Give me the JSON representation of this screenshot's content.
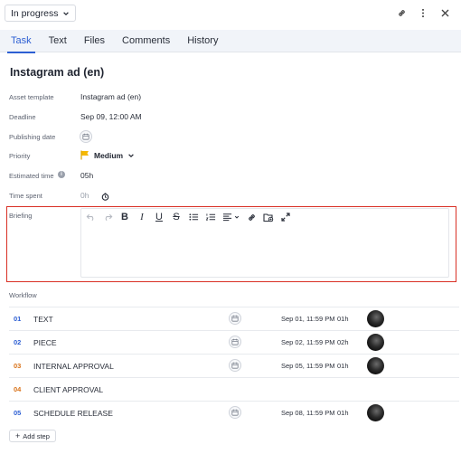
{
  "status": {
    "label": "In progress"
  },
  "tabs": [
    {
      "label": "Task"
    },
    {
      "label": "Text"
    },
    {
      "label": "Files"
    },
    {
      "label": "Comments"
    },
    {
      "label": "History"
    }
  ],
  "title": "Instagram ad (en)",
  "fields": {
    "asset_template": {
      "label": "Asset template",
      "value": "Instagram ad (en)"
    },
    "deadline": {
      "label": "Deadline",
      "value": "Sep 09, 12:00 AM"
    },
    "publishing_date": {
      "label": "Publishing date"
    },
    "priority": {
      "label": "Priority",
      "value": "Medium",
      "flag_color": "#f5b800"
    },
    "estimated_time": {
      "label": "Estimated time",
      "value": "05h"
    },
    "time_spent": {
      "label": "Time spent",
      "placeholder": "0h"
    }
  },
  "briefing": {
    "label": "Briefing"
  },
  "workflow": {
    "label": "Workflow",
    "steps": [
      {
        "num": "01",
        "name": "TEXT",
        "date": "Sep 01, 11:59 PM",
        "time": "01h",
        "color": "#2d5fd3",
        "has_date": true,
        "has_avatar": true
      },
      {
        "num": "02",
        "name": "PIECE",
        "date": "Sep 02, 11:59 PM",
        "time": "02h",
        "color": "#2d5fd3",
        "has_date": true,
        "has_avatar": true
      },
      {
        "num": "03",
        "name": "INTERNAL APPROVAL",
        "date": "Sep 05, 11:59 PM",
        "time": "01h",
        "color": "#d9731a",
        "has_date": true,
        "has_avatar": true
      },
      {
        "num": "04",
        "name": "CLIENT APPROVAL",
        "date": "",
        "time": "",
        "color": "#d9731a",
        "has_date": false,
        "has_avatar": false
      },
      {
        "num": "05",
        "name": "SCHEDULE RELEASE",
        "date": "Sep 08, 11:59 PM",
        "time": "01h",
        "color": "#2d5fd3",
        "has_date": true,
        "has_avatar": true
      }
    ]
  },
  "add_step": {
    "label": "Add step"
  },
  "colors": {
    "accent": "#2d5fd3",
    "highlight_border": "#d93025"
  }
}
